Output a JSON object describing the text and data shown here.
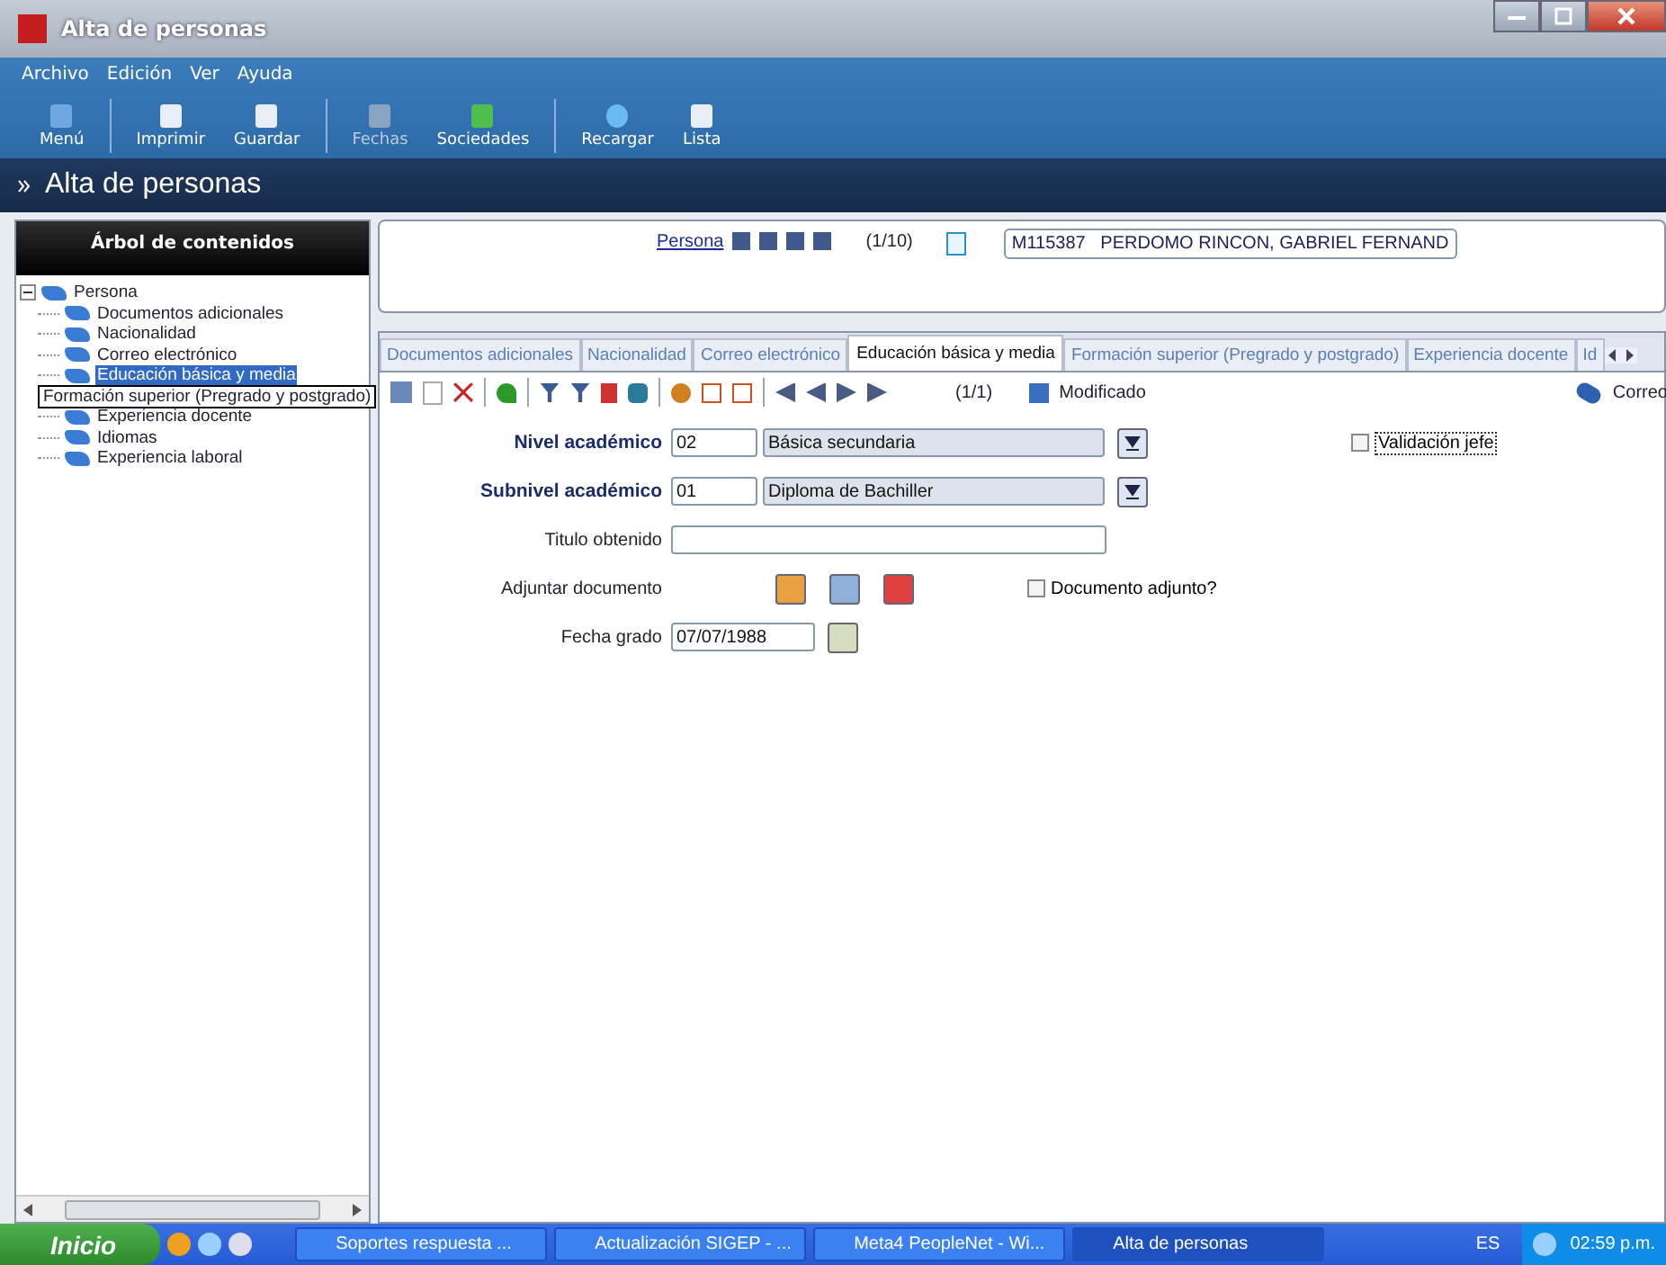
{
  "window": {
    "title": "Alta de personas"
  },
  "menu": [
    "Archivo",
    "Edición",
    "Ver",
    "Ayuda"
  ],
  "toolbar": [
    {
      "label": "Menú",
      "disabled": false,
      "sep_after": true
    },
    {
      "label": "Imprimir",
      "disabled": false,
      "sep_after": false
    },
    {
      "label": "Guardar",
      "disabled": false,
      "sep_after": true
    },
    {
      "label": "Fechas",
      "disabled": true,
      "sep_after": false
    },
    {
      "label": "Sociedades",
      "disabled": false,
      "sep_after": true
    },
    {
      "label": "Recargar",
      "disabled": false,
      "sep_after": false
    },
    {
      "label": "Lista",
      "disabled": false,
      "sep_after": false
    }
  ],
  "page_header": "Alta de personas",
  "tree": {
    "title": "Árbol de contenidos",
    "root": {
      "label": "Persona",
      "expanded": true,
      "children": [
        {
          "label": "Documentos adicionales",
          "selected": false,
          "tooltip": false
        },
        {
          "label": "Nacionalidad",
          "selected": false,
          "tooltip": false
        },
        {
          "label": "Correo electrónico",
          "selected": false,
          "tooltip": false
        },
        {
          "label": "Educación  básica y media",
          "selected": true,
          "tooltip": false
        },
        {
          "label": "Formación superior (Pregrado y postgrado)",
          "selected": false,
          "tooltip": true
        },
        {
          "label": "Experiencia docente",
          "selected": false,
          "tooltip": false
        },
        {
          "label": "Idiomas",
          "selected": false,
          "tooltip": false
        },
        {
          "label": "Experiencia laboral",
          "selected": false,
          "tooltip": false
        }
      ]
    }
  },
  "record": {
    "link": "Persona",
    "counter": "(1/10)",
    "value": "M115387   PERDOMO RINCON, GABRIEL FERNAND"
  },
  "tabs": [
    {
      "label": "Documentos adicionales",
      "selected": false
    },
    {
      "label": "Nacionalidad",
      "selected": false
    },
    {
      "label": "Correo electrónico",
      "selected": false
    },
    {
      "label": "Educación  básica y media",
      "selected": true
    },
    {
      "label": "Formación superior (Pregrado y postgrado)",
      "selected": false
    },
    {
      "label": "Experiencia docente",
      "selected": false
    },
    {
      "label": "Id",
      "selected": false
    }
  ],
  "subtoolbar": {
    "counter": "(1/1)",
    "status": "Modificado",
    "mail": "Correo"
  },
  "form": {
    "nivel": {
      "label": "Nivel académico",
      "code": "02",
      "description": "Básica secundaria"
    },
    "subnivel": {
      "label": "Subnivel académico",
      "code": "01",
      "description": "Diploma de Bachiller"
    },
    "validacion": {
      "label": "Validación jefe",
      "checked": false
    },
    "titulo": {
      "label": "Titulo obtenido"
    },
    "adjuntar": {
      "label": "Adjuntar documento"
    },
    "adjunto": {
      "label": "Documento adjunto?",
      "checked": false
    },
    "fecha": {
      "label": "Fecha grado",
      "value": "07/07/1988"
    }
  },
  "taskbar": {
    "start": "Inicio",
    "tasks": [
      {
        "label": "Soportes respuesta ...",
        "selected": false
      },
      {
        "label": "Actualización SIGEP - ...",
        "selected": false
      },
      {
        "label": "Meta4 PeopleNet - Wi...",
        "selected": false
      },
      {
        "label": "Alta de personas",
        "selected": true
      }
    ],
    "lang": "ES",
    "clock": "02:59 p.m."
  }
}
